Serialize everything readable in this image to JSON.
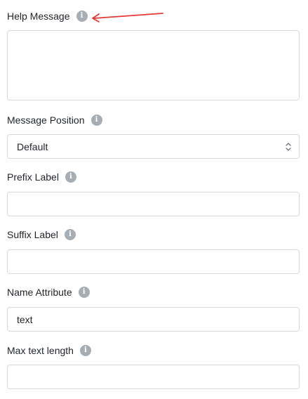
{
  "fields": {
    "help_message": {
      "label": "Help Message",
      "value": "",
      "placeholder": ""
    },
    "message_position": {
      "label": "Message Position",
      "selected": "Default"
    },
    "prefix_label": {
      "label": "Prefix Label",
      "value": "",
      "placeholder": ""
    },
    "suffix_label": {
      "label": "Suffix Label",
      "value": "",
      "placeholder": ""
    },
    "name_attribute": {
      "label": "Name Attribute",
      "value": "text",
      "placeholder": ""
    },
    "max_text_length": {
      "label": "Max text length",
      "value": "",
      "placeholder": ""
    }
  },
  "icons": {
    "info": "info-icon",
    "select_chevrons": "chevron-up-down-icon",
    "annotation": "red-arrow"
  },
  "colors": {
    "info_icon": "#a6adb5",
    "border": "#d4d9de",
    "annotation_arrow": "#e53935"
  }
}
